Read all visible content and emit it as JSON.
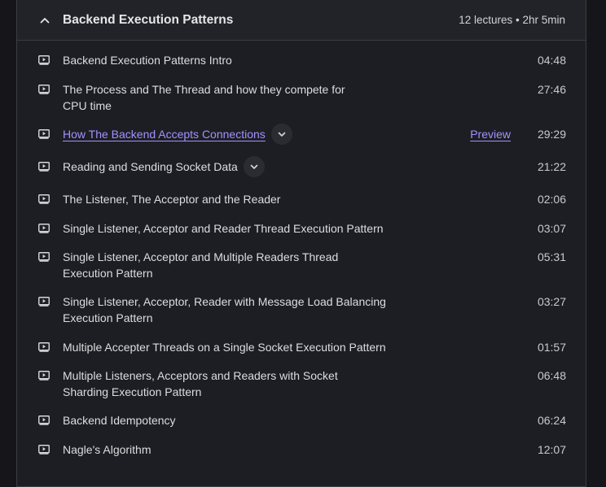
{
  "section": {
    "title": "Backend Execution Patterns",
    "meta": "12 lectures • 2hr 5min"
  },
  "lectures": [
    {
      "title": "Backend Execution Patterns Intro",
      "duration": "04:48"
    },
    {
      "title": "The Process and The Thread and how they compete for CPU time",
      "duration": "27:46"
    },
    {
      "title": "How The Backend Accepts Connections",
      "duration": "29:29",
      "preview": "Preview"
    },
    {
      "title": "Reading and Sending Socket Data",
      "duration": "21:22"
    },
    {
      "title": "The Listener, The Acceptor and the Reader",
      "duration": "02:06"
    },
    {
      "title": "Single Listener, Acceptor and Reader Thread Execution Pattern",
      "duration": "03:07"
    },
    {
      "title": "Single Listener, Acceptor and Multiple Readers Thread Execution Pattern",
      "duration": "05:31"
    },
    {
      "title": "Single Listener, Acceptor, Reader with Message Load Balancing Execution Pattern",
      "duration": "03:27"
    },
    {
      "title": "Multiple Accepter Threads on a Single Socket Execution Pattern",
      "duration": "01:57"
    },
    {
      "title": "Multiple Listeners, Acceptors and Readers with Socket Sharding Execution Pattern",
      "duration": "06:48"
    },
    {
      "title": "Backend Idempotency",
      "duration": "06:24"
    },
    {
      "title": "Nagle's Algorithm",
      "duration": "12:07"
    }
  ],
  "icons": {
    "collapse": "chevron-up-icon",
    "lecture": "video-play-icon",
    "expand": "chevron-down-icon"
  },
  "colors": {
    "link": "#a490ff",
    "background": "#1d1e23",
    "header": "#222328"
  }
}
